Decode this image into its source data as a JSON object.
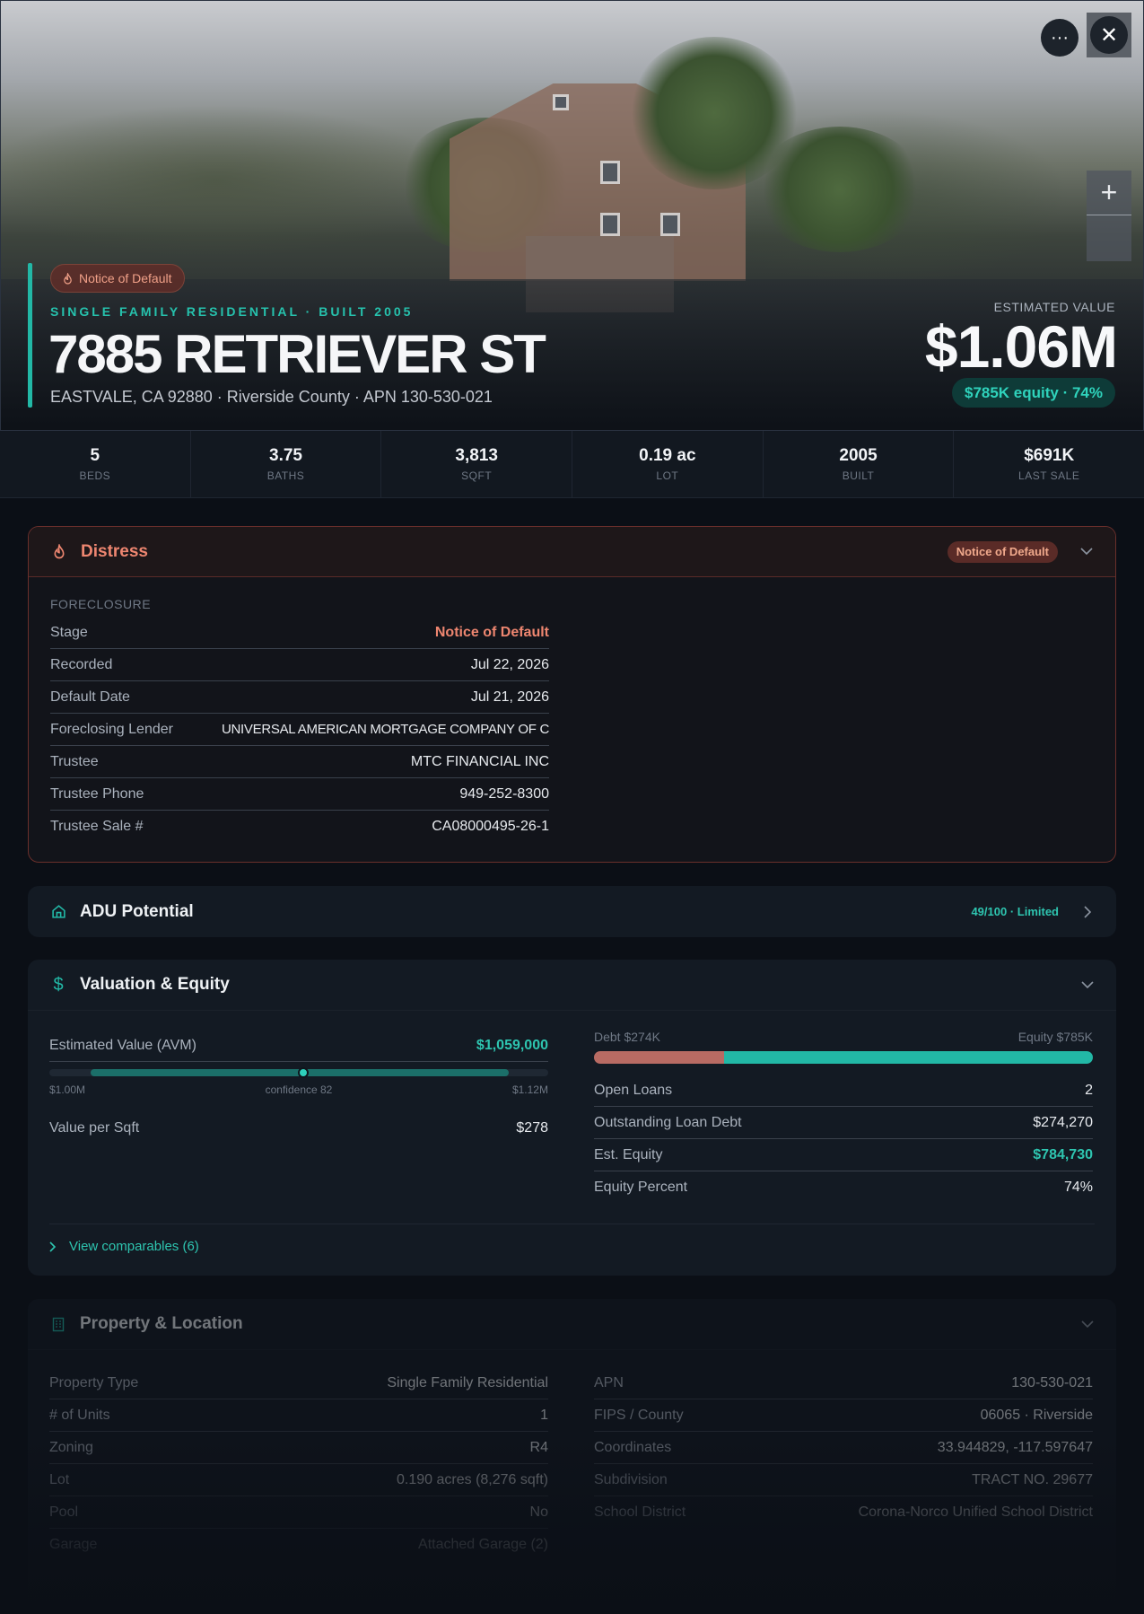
{
  "hero": {
    "badge": "Notice of Default",
    "eyebrow": "SINGLE FAMILY RESIDENTIAL · BUILT 2005",
    "address": "7885 RETRIEVER ST",
    "subaddress": "EASTVALE, CA 92880 · Riverside County · APN 130-530-021",
    "estimated_label": "ESTIMATED VALUE",
    "estimated_value": "$1.06M",
    "equity_pill": "$785K equity · 74%",
    "more_label": "···",
    "close_label": "✕",
    "zoom_plus": "+"
  },
  "stats": [
    {
      "value": "5",
      "label": "BEDS"
    },
    {
      "value": "3.75",
      "label": "BATHS"
    },
    {
      "value": "3,813",
      "label": "SQFT"
    },
    {
      "value": "0.19 ac",
      "label": "LOT"
    },
    {
      "value": "2005",
      "label": "BUILT"
    },
    {
      "value": "$691K",
      "label": "LAST SALE"
    }
  ],
  "distress": {
    "title": "Distress",
    "badge": "Notice of Default",
    "section": "FORECLOSURE",
    "rows": [
      {
        "k": "Stage",
        "v": "Notice of Default"
      },
      {
        "k": "Recorded",
        "v": "Jul 22, 2026"
      },
      {
        "k": "Default Date",
        "v": "Jul 21, 2026"
      },
      {
        "k": "Foreclosing Lender",
        "v": "UNIVERSAL AMERICAN MORTGAGE COMPANY OF C"
      },
      {
        "k": "Trustee",
        "v": "MTC FINANCIAL INC"
      },
      {
        "k": "Trustee Phone",
        "v": "949-252-8300"
      },
      {
        "k": "Trustee Sale #",
        "v": "CA08000495-26-1"
      }
    ]
  },
  "adu": {
    "title": "ADU Potential",
    "score": "49/100 · Limited"
  },
  "valuation": {
    "title": "Valuation & Equity",
    "avm_label": "Estimated Value (AVM)",
    "avm_value": "$1,059,000",
    "avm_low": "$1.00M",
    "avm_confidence": "confidence 82",
    "avm_high": "$1.12M",
    "ppsf_label": "Value per Sqft",
    "ppsf_value": "$278",
    "debt_label": "Debt $274K",
    "equity_label": "Equity $785K",
    "debt_fraction": 0.26,
    "rows": [
      {
        "k": "Open Loans",
        "v": "2"
      },
      {
        "k": "Outstanding Loan Debt",
        "v": "$274,270"
      },
      {
        "k": "Est. Equity",
        "v": "$784,730"
      },
      {
        "k": "Equity Percent",
        "v": "74%"
      }
    ],
    "comparables": "View comparables (6)"
  },
  "property": {
    "title": "Property & Location",
    "left": [
      {
        "k": "Property Type",
        "v": "Single Family Residential"
      },
      {
        "k": "# of Units",
        "v": "1"
      },
      {
        "k": "Zoning",
        "v": "R4"
      },
      {
        "k": "Lot",
        "v": "0.190 acres (8,276 sqft)"
      },
      {
        "k": "Pool",
        "v": "No"
      },
      {
        "k": "Garage",
        "v": "Attached Garage (2)"
      }
    ],
    "right": [
      {
        "k": "APN",
        "v": "130-530-021"
      },
      {
        "k": "FIPS / County",
        "v": "06065 · Riverside"
      },
      {
        "k": "Coordinates",
        "v": "33.944829, -117.597647"
      },
      {
        "k": "Subdivision",
        "v": "TRACT NO. 29677"
      },
      {
        "k": "School District",
        "v": "Corona-Norco Unified School District"
      }
    ]
  },
  "colors": {
    "accent": "#22b8a6",
    "distress": "#ee8670",
    "debt": "#b86b63"
  }
}
